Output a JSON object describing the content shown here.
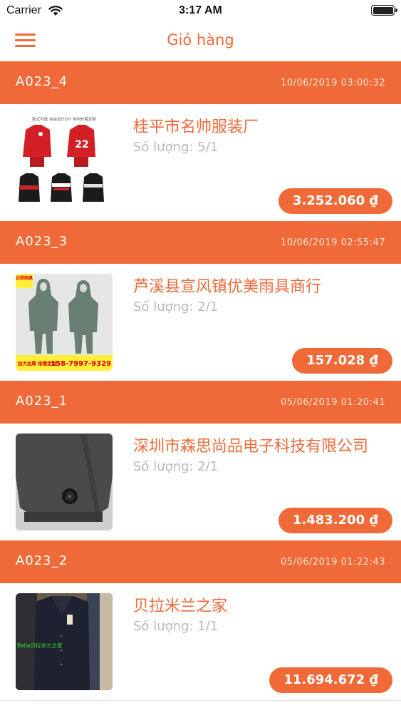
{
  "status": {
    "carrier": "Carrier",
    "time": "3:17 AM"
  },
  "nav": {
    "title": "Giỏ hàng"
  },
  "orders": [
    {
      "id": "A023_4",
      "date": "10/06/2019 03:00:32",
      "shop": "桂平市名帅服装厂",
      "qty": "Số lượng: 5/1",
      "price": "3.252.060 ₫"
    },
    {
      "id": "A023_3",
      "date": "10/06/2019 02:55:47",
      "shop": "芦溪县宣风镇优美雨具商行",
      "qty": "Số lượng: 2/1",
      "price": "157.028 ₫"
    },
    {
      "id": "A023_1",
      "date": "05/06/2019 01:20:41",
      "shop": "深圳市森思尚品电子科技有限公司",
      "qty": "Số lượng: 2/1",
      "price": "1.483.200 ₫"
    },
    {
      "id": "A023_2",
      "date": "05/06/2019 01:22:43",
      "shop": "贝拉米兰之家",
      "qty": "Số lượng: 1/1",
      "price": "11.694.672 ₫"
    }
  ],
  "thumb_text": {
    "o1_top": "款式可选 自由设计DIY 休闲外套定制",
    "o1_number": "22",
    "o2_tag": "优质雨具",
    "o2_promo": "加大加厚 按需定制",
    "o2_phone": "158-7997-9329",
    "o4_brand": "Bella贝拉米兰之家"
  },
  "colors": {
    "accent": "#ef6a38",
    "header_date": "#fde3d6",
    "qty": "#b8b8b8"
  },
  "icons": {
    "menu": "hamburger-menu-icon",
    "wifi": "wifi-icon",
    "battery": "battery-icon"
  }
}
